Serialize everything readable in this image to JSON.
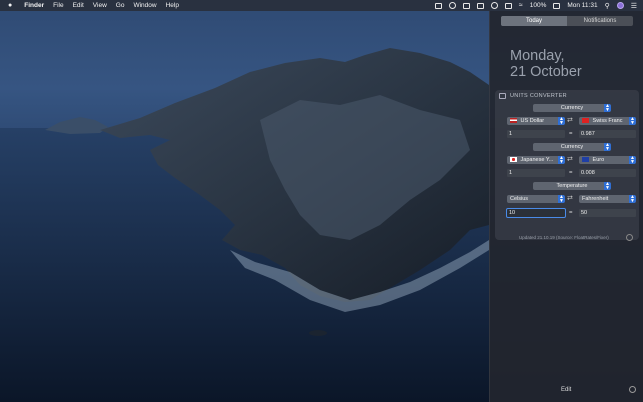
{
  "menubar": {
    "apple": "",
    "app": "Finder",
    "items": [
      "File",
      "Edit",
      "View",
      "Go",
      "Window",
      "Help"
    ],
    "battery": "100%",
    "clock": "Mon 11:31"
  },
  "panel": {
    "tabs": [
      "Today",
      "Notifications"
    ],
    "date_line1": "Monday,",
    "date_line2": "21 October",
    "widget": {
      "title": "UNITS CONVERTER",
      "rows": [
        {
          "category": "Currency",
          "from_unit": "US Dollar",
          "to_unit": "Swiss Franc",
          "input": "1",
          "equals": "=",
          "result": "0.987"
        },
        {
          "category": "Currency",
          "from_unit": "Japanese Y...",
          "to_unit": "Euro",
          "input": "1",
          "equals": "=",
          "result": "0.008"
        },
        {
          "category": "Temperature",
          "from_unit": "Celsius",
          "to_unit": "Fahrenheit",
          "input": "10",
          "equals": "=",
          "result": "50"
        }
      ],
      "updated": "Updated 21.10.19 (Source: FloatRates/Fixer)"
    },
    "edit_label": "Edit"
  }
}
